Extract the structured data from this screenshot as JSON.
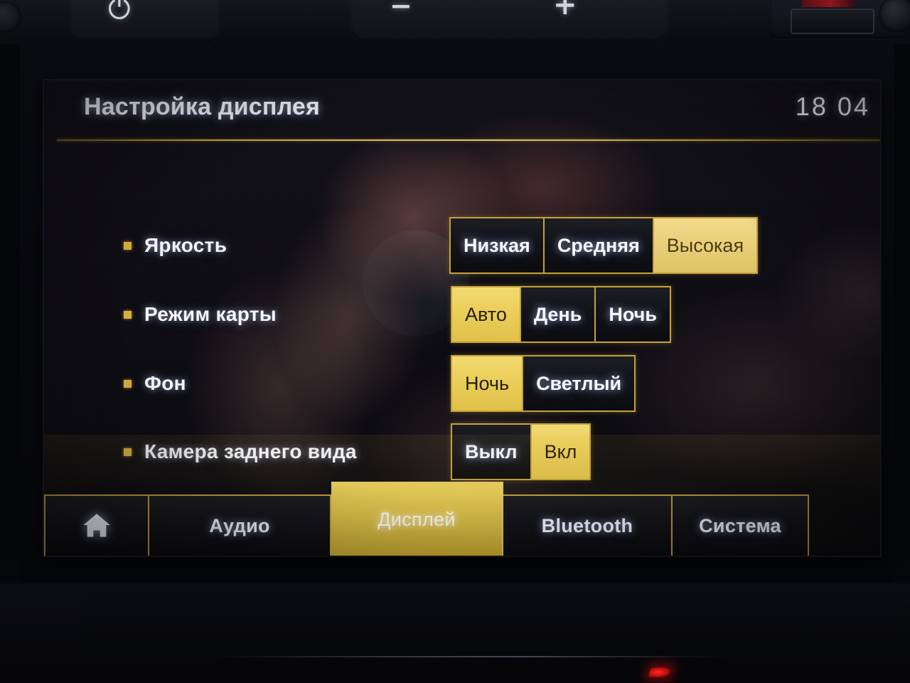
{
  "hardware": {
    "power_glyph": "⏻",
    "volume_down_glyph": "−",
    "volume_up_glyph": "+"
  },
  "header": {
    "title": "Настройка дисплея",
    "clock": "18 04"
  },
  "settings": [
    {
      "label": "Яркость",
      "name": "brightness",
      "options": [
        {
          "text": "Низкая",
          "selected": false
        },
        {
          "text": "Средняя",
          "selected": false
        },
        {
          "text": "Высокая",
          "selected": true
        }
      ]
    },
    {
      "label": "Режим карты",
      "name": "map-mode",
      "options": [
        {
          "text": "Авто",
          "selected": true
        },
        {
          "text": "День",
          "selected": false
        },
        {
          "text": "Ночь",
          "selected": false
        }
      ]
    },
    {
      "label": "Фон",
      "name": "background",
      "options": [
        {
          "text": "Ночь",
          "selected": true
        },
        {
          "text": "Светлый",
          "selected": false
        }
      ]
    },
    {
      "label": "Камера заднего вида",
      "name": "rear-view-camera",
      "options": [
        {
          "text": "Выкл",
          "selected": false
        },
        {
          "text": "Вкл",
          "selected": true
        }
      ]
    }
  ],
  "tabs": [
    {
      "label": "",
      "icon": "home-icon",
      "name": "home",
      "active": false
    },
    {
      "label": "Аудио",
      "icon": null,
      "name": "audio",
      "active": false
    },
    {
      "label": "Дисплей",
      "icon": null,
      "name": "display",
      "active": true
    },
    {
      "label": "Bluetooth",
      "icon": null,
      "name": "bluetooth",
      "active": false
    },
    {
      "label": "Система",
      "icon": null,
      "name": "system",
      "active": false
    }
  ],
  "colors": {
    "accent_gold": "#dcc04a",
    "accent_gold_border": "#c4a13a",
    "screen_bg": "#0c0b10",
    "text_light": "#f4f6fc",
    "text_on_gold": "#241d05",
    "bullet": "#dcb33d"
  }
}
